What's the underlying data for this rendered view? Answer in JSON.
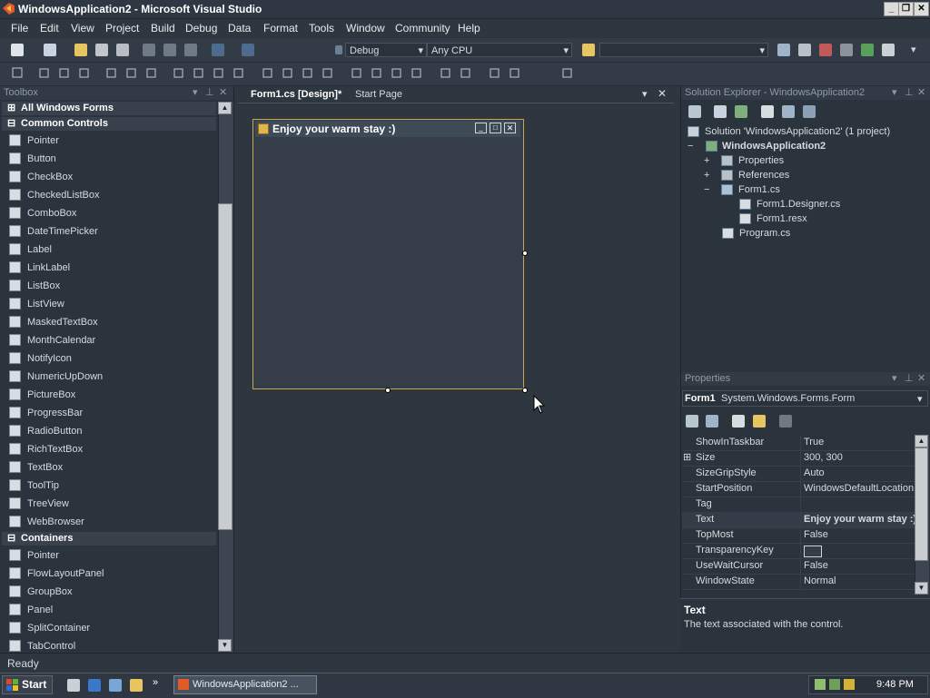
{
  "window": {
    "title": "WindowsApplication2 - Microsoft Visual Studio"
  },
  "menu": [
    "File",
    "Edit",
    "View",
    "Project",
    "Build",
    "Debug",
    "Data",
    "Format",
    "Tools",
    "Window",
    "Community",
    "Help"
  ],
  "toolbar": {
    "config": "Debug",
    "platform": "Any CPU"
  },
  "toolbox": {
    "title": "Toolbox",
    "group_all": "All Windows Forms",
    "group_common": "Common Controls",
    "common_items": [
      "Pointer",
      "Button",
      "CheckBox",
      "CheckedListBox",
      "ComboBox",
      "DateTimePicker",
      "Label",
      "LinkLabel",
      "ListBox",
      "ListView",
      "MaskedTextBox",
      "MonthCalendar",
      "NotifyIcon",
      "NumericUpDown",
      "PictureBox",
      "ProgressBar",
      "RadioButton",
      "RichTextBox",
      "TextBox",
      "ToolTip",
      "TreeView",
      "WebBrowser"
    ],
    "group_containers": "Containers",
    "container_items": [
      "Pointer",
      "FlowLayoutPanel",
      "GroupBox",
      "Panel",
      "SplitContainer",
      "TabControl"
    ],
    "scroll_position": 0.45
  },
  "doc_tabs": {
    "active": "Form1.cs [Design]*",
    "other": "Start Page"
  },
  "form": {
    "title": "Enjoy your warm stay :)"
  },
  "solution_explorer": {
    "title": "Solution Explorer - WindowsApplication2",
    "solution": "Solution 'WindowsApplication2' (1 project)",
    "project": "WindowsApplication2",
    "properties": "Properties",
    "references": "References",
    "form_file": "Form1.cs",
    "designer_file": "Form1.Designer.cs",
    "resx_file": "Form1.resx",
    "program_file": "Program.cs"
  },
  "properties": {
    "title": "Properties",
    "object_name": "Form1",
    "object_type": "System.Windows.Forms.Form",
    "rows": [
      {
        "name": "ShowInTaskbar",
        "value": "True"
      },
      {
        "name": "Size",
        "value": "300, 300"
      },
      {
        "name": "SizeGripStyle",
        "value": "Auto"
      },
      {
        "name": "StartPosition",
        "value": "WindowsDefaultLocation"
      },
      {
        "name": "Tag",
        "value": ""
      },
      {
        "name": "Text",
        "value": "Enjoy your warm stay :)"
      },
      {
        "name": "TopMost",
        "value": "False"
      },
      {
        "name": "TransparencyKey",
        "value": ""
      },
      {
        "name": "UseWaitCursor",
        "value": "False"
      },
      {
        "name": "WindowState",
        "value": "Normal"
      }
    ],
    "desc_title": "Text",
    "desc_text": "The text associated with the control."
  },
  "status": {
    "text": "Ready"
  },
  "taskbar": {
    "start": "Start",
    "task": "WindowsApplication2 ...",
    "clock": "9:48 PM"
  },
  "colors": {
    "accent": "#c9a74a",
    "background": "#2e3640"
  }
}
